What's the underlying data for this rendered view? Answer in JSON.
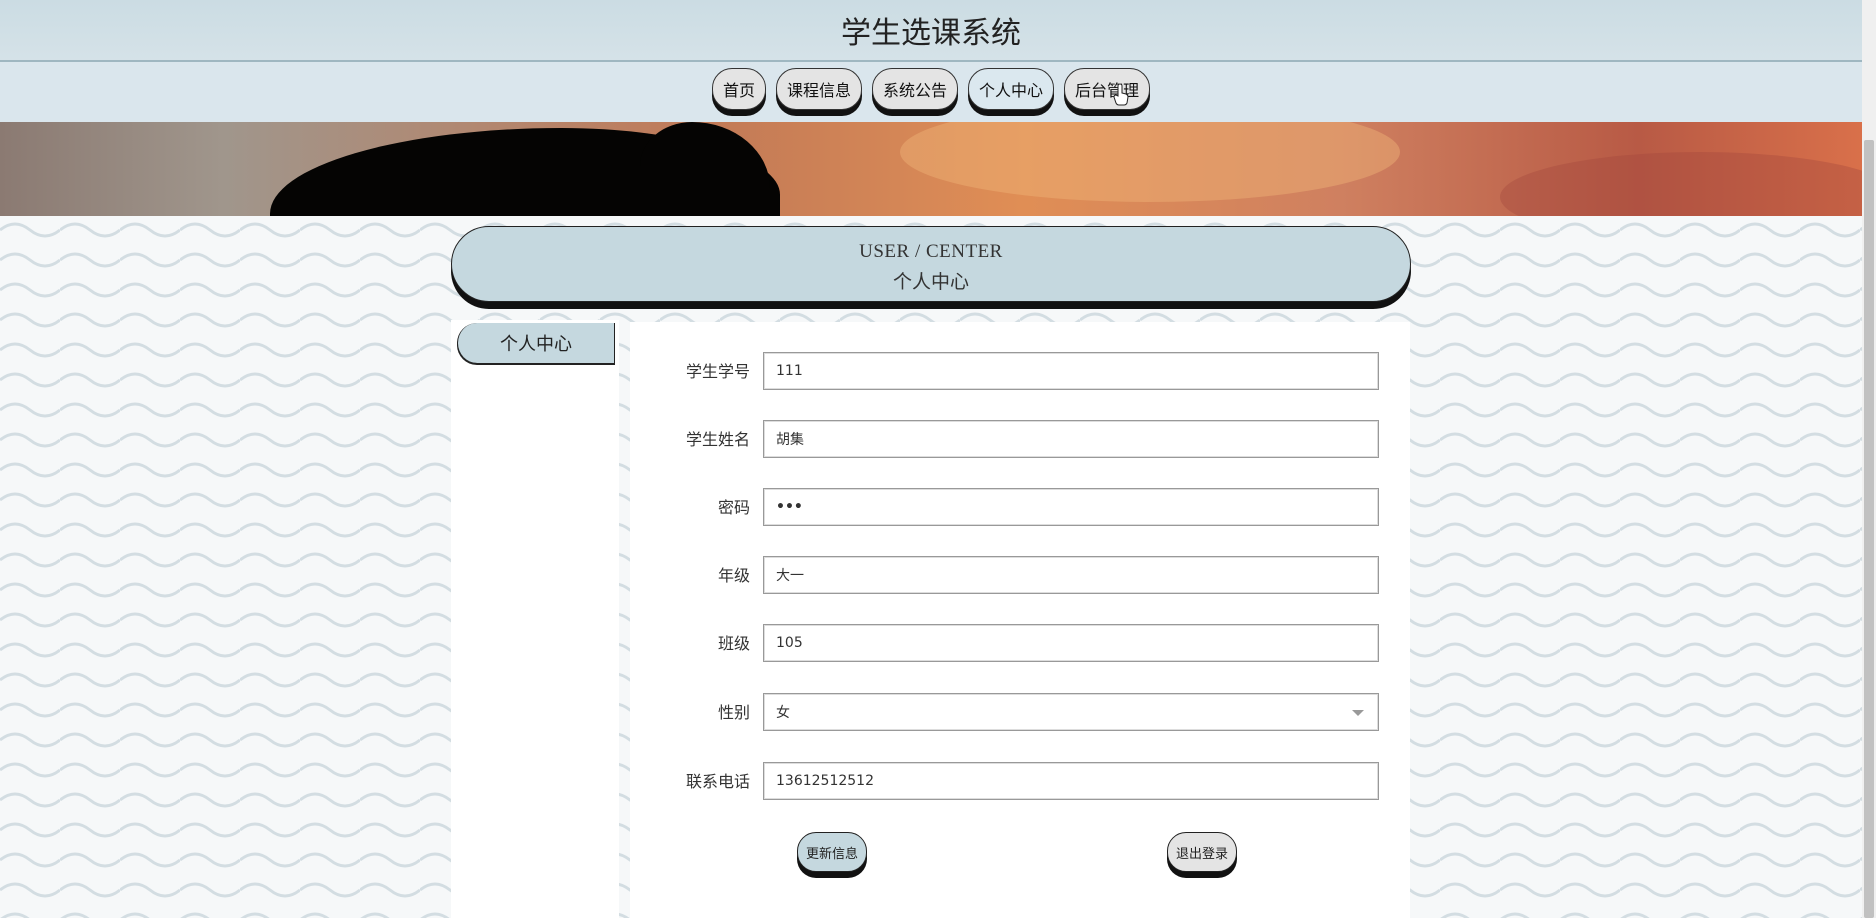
{
  "header": {
    "title": "学生选课系统"
  },
  "nav": {
    "items": [
      {
        "label": "首页"
      },
      {
        "label": "课程信息"
      },
      {
        "label": "系统公告"
      },
      {
        "label": "个人中心"
      },
      {
        "label": "后台管理"
      }
    ],
    "active_index": 3
  },
  "section": {
    "title_en": "USER / CENTER",
    "title_cn": "个人中心"
  },
  "sidebar": {
    "items": [
      {
        "label": "个人中心"
      }
    ]
  },
  "form": {
    "fields": [
      {
        "label": "学生学号",
        "value": "111"
      },
      {
        "label": "学生姓名",
        "value": "胡集"
      },
      {
        "label": "密码",
        "value": "•••"
      },
      {
        "label": "年级",
        "value": "大一"
      },
      {
        "label": "班级",
        "value": "105"
      },
      {
        "label": "性别",
        "value": "女"
      },
      {
        "label": "联系电话",
        "value": "13612512512"
      }
    ],
    "update_label": "更新信息",
    "logout_label": "退出登录"
  },
  "colors": {
    "accent": "#c5d8df",
    "nav_bg": "#dae6ed",
    "button_gray": "#e4e4e4"
  }
}
